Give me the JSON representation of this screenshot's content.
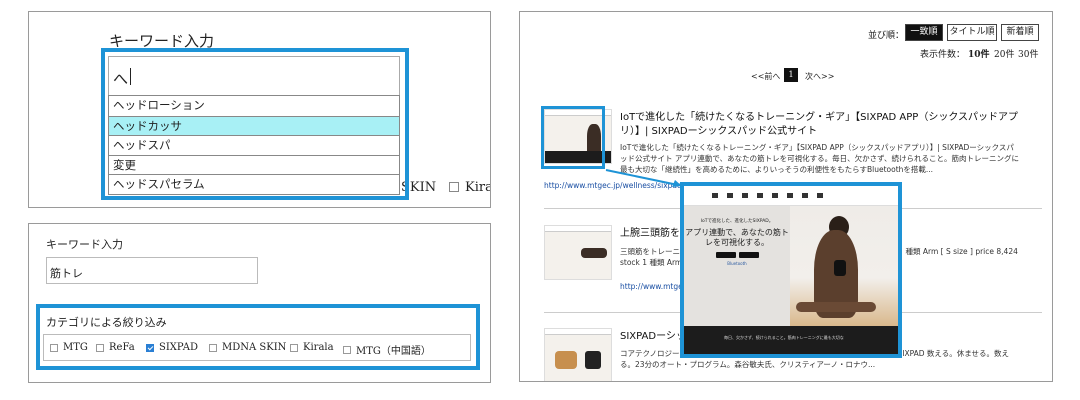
{
  "autocomplete": {
    "title": "キーワード入力",
    "input_value": "へ",
    "suggestions": [
      "ヘッドローション",
      "ヘッドカッサ",
      "ヘッドスパ",
      "変更",
      "ヘッドスパセラム"
    ],
    "highlighted_index": 1,
    "behind_text_1": "SKIN",
    "behind_text_2": "Kiral"
  },
  "filter": {
    "title": "キーワード入力",
    "keyword_value": "筋トレ",
    "category_heading": "カテゴリによる絞り込み",
    "categories": [
      {
        "label": "MTG",
        "checked": false
      },
      {
        "label": "ReFa",
        "checked": false
      },
      {
        "label": "SIXPAD",
        "checked": true
      },
      {
        "label": "MDNA SKIN",
        "checked": false
      },
      {
        "label": "Kirala",
        "checked": false
      },
      {
        "label": "MTG（中国語）",
        "checked": false
      }
    ]
  },
  "results": {
    "sort_label": "並び順：",
    "sort_options": [
      "一致順",
      "タイトル順",
      "新着順"
    ],
    "sort_active": 0,
    "count_label": "表示件数：",
    "count_options": [
      "10件",
      "20件",
      "30件"
    ],
    "prev": "<<前へ",
    "current_page": "1",
    "next": "次へ>>",
    "items": [
      {
        "title": "IoTで進化した「続けたくなるトレーニング・ギア」【SIXPAD APP（シックスパッドアプリ）】| SIXPADーシックスパッド公式サイト",
        "desc": "IoTで進化した「続けたくなるトレーニング・ギア」【SIXPAD APP（シックスパッドアプリ）】| SIXPADーシックスパッド公式サイト アプリ連動で、あなたの筋トレを可視化する。毎日、欠かさず、続けられること。筋肉トレーニングに最も大切な「継続性」を高めるために、よりいっそうの利便性をもたらすBluetoothを搭載...",
        "url": "http://www.mtgec.jp/wellness/sixpad/app/"
      },
      {
        "title": "上腕三頭筋をト                                                                                    式サイト Training Suit",
        "desc": "三頭筋をトレーニン                                                                            Training Suit 着けて過ごす。その時間がトレーニングになる。                                                                    種類 Arm [ S size ] price 8,424 stock 1 種類 Arm [ M size ]                                                              size ] price 8,424 stock...",
        "url": "http://www.mtgec.jp/"
      },
      {
        "title": "SIXPADーシック",
        "desc": "コアテクノロジー「C                                                                                  CMM Pulseは、MTGの登録商標です。IoTで広がる進化したSIXPAD                                                                            数える。休ませる。数える。23分のオート・プログラム。森谷敏夫氏、クリスティアーノ・ロナウ...",
        "url": ""
      }
    ]
  },
  "zoom": {
    "promo_small": "IoTで進化した、進化したSIXPAD。",
    "promo_big": "アプリ連動で、あなたの筋トレを可視化する。",
    "bluetooth": "Bluetooth",
    "bottom_text": "毎日、欠かさず、続けられること。筋肉トレーニングに最も大切な"
  }
}
